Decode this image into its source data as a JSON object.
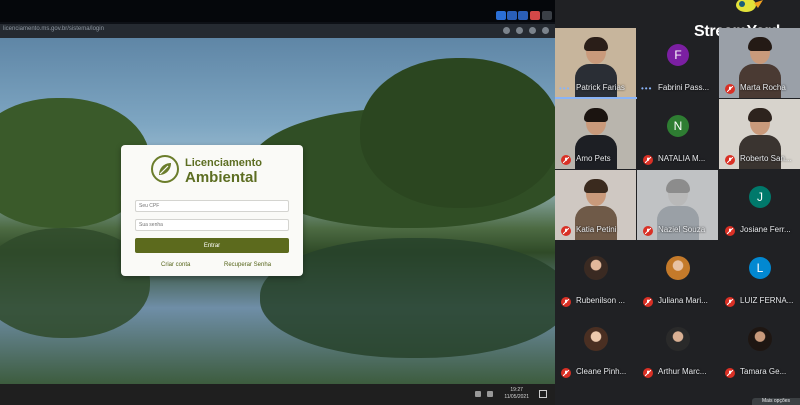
{
  "browser": {
    "url": "licenciamento.ms.gov.br/sistema/login"
  },
  "login": {
    "logo_line1": "Licenciamento",
    "logo_line2": "Ambiental",
    "cpf_placeholder": "Seu CPF",
    "password_placeholder": "Sua senha",
    "enter_label": "Entrar",
    "create_account": "Criar conta",
    "recover_password": "Recuperar Senha"
  },
  "taskbar": {
    "time": "19:27",
    "date": "11/05/2021"
  },
  "brand": {
    "name": "StreamYard"
  },
  "colors": {
    "accent_green": "#5c6a1d",
    "muted_red": "#d93025",
    "speaking_blue": "#8ab4f8",
    "panel_bg": "#202124"
  },
  "participants": [
    {
      "name": "Patrick Farias",
      "muted": false,
      "tile": "photo",
      "icon": "speaking-dots"
    },
    {
      "name": "Fabrini Pass...",
      "muted": false,
      "initial": "F",
      "color": "#7b1fa2",
      "icon": "speaking-dots"
    },
    {
      "name": "Marta Rocha",
      "muted": true,
      "tile": "photo"
    },
    {
      "name": "Amo Pets",
      "muted": true,
      "tile": "photo"
    },
    {
      "name": "NATALIA M...",
      "muted": true,
      "initial": "N",
      "color": "#2e7d32"
    },
    {
      "name": "Roberto San...",
      "muted": true,
      "tile": "photo"
    },
    {
      "name": "Katia Petini",
      "muted": true,
      "tile": "photo"
    },
    {
      "name": "Naziel Souza",
      "muted": true,
      "tile": "photo"
    },
    {
      "name": "Josiane Ferr...",
      "muted": true,
      "initial": "J",
      "color": "#00796b"
    },
    {
      "name": "Rubenilson ...",
      "muted": true,
      "tile": "avatar"
    },
    {
      "name": "Juliana Mari...",
      "muted": true,
      "tile": "avatar"
    },
    {
      "name": "LUIZ FERNA...",
      "muted": true,
      "initial": "L",
      "color": "#0288d1"
    },
    {
      "name": "Cleane Pinh...",
      "muted": true,
      "tile": "avatar"
    },
    {
      "name": "Arthur Marc...",
      "muted": true,
      "tile": "avatar"
    },
    {
      "name": "Tamara Ge...",
      "muted": true,
      "tile": "avatar"
    }
  ],
  "more_options": "Mais opções"
}
